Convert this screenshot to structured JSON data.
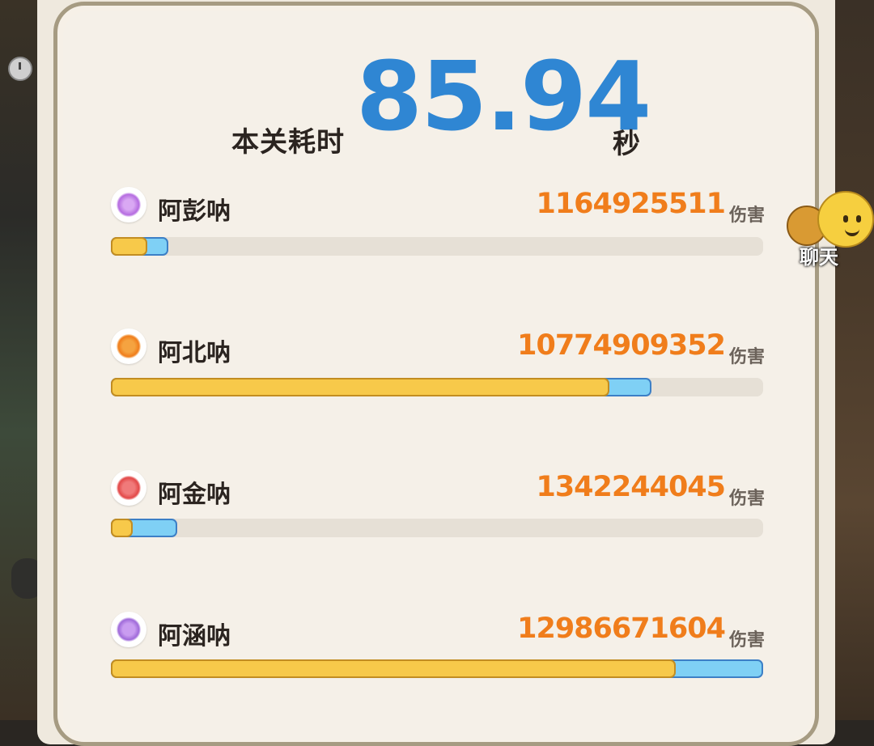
{
  "header": {
    "label": "本关耗时",
    "time": "85.94",
    "unit": "秒"
  },
  "damage_unit": "伤害",
  "players": [
    {
      "name": "阿彭呐",
      "damage": "1164925511",
      "icon": "purple-swirl-icon",
      "yellow_fraction": 0.056,
      "blue_fraction": 0.088
    },
    {
      "name": "阿北呐",
      "damage": "10774909352",
      "icon": "orange-sword-icon",
      "yellow_fraction": 0.764,
      "blue_fraction": 0.829
    },
    {
      "name": "阿金呐",
      "damage": "1342244045",
      "icon": "red-demon-icon",
      "yellow_fraction": 0.034,
      "blue_fraction": 0.102
    },
    {
      "name": "阿涵呐",
      "damage": "12986671604",
      "icon": "purple-wing-icon",
      "yellow_fraction": 0.866,
      "blue_fraction": 1.0
    }
  ],
  "chat": {
    "label": "聊天"
  },
  "colors": {
    "time": "#2f86d3",
    "damage": "#f07d1b",
    "bar_yellow": "#f7c94a",
    "bar_blue": "#7fd0f5"
  }
}
